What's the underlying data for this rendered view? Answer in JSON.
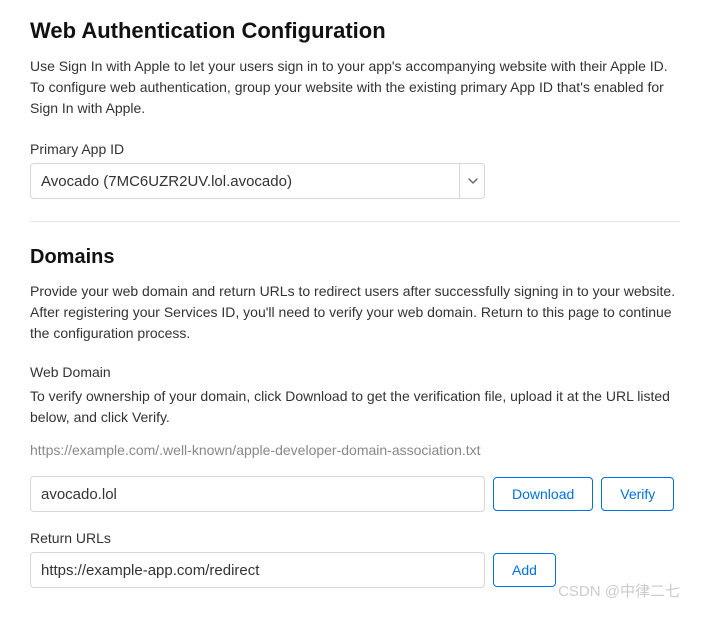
{
  "header": {
    "title": "Web Authentication Configuration",
    "intro": "Use Sign In with Apple to let your users sign in to your app's accompanying website with their Apple ID. To configure web authentication, group your website with the existing primary App ID that's enabled for Sign In with Apple."
  },
  "primaryApp": {
    "label": "Primary App ID",
    "value": "Avocado (7MC6UZR2UV.lol.avocado)"
  },
  "domains": {
    "title": "Domains",
    "intro": "Provide your web domain and return URLs to redirect users after successfully signing in to your website. After registering your Services ID, you'll need to verify your web domain. Return to this page to continue the configuration process.",
    "webDomain": {
      "label": "Web Domain",
      "sublabel": "To verify ownership of your domain, click Download to get the verification file, upload it at the URL listed below, and click Verify.",
      "hintPath": "https://example.com/.well-known/apple-developer-domain-association.txt",
      "value": "avocado.lol",
      "downloadLabel": "Download",
      "verifyLabel": "Verify"
    },
    "returnUrls": {
      "label": "Return URLs",
      "value": "https://example-app.com/redirect",
      "addLabel": "Add"
    }
  },
  "watermark": "CSDN @中律二七"
}
